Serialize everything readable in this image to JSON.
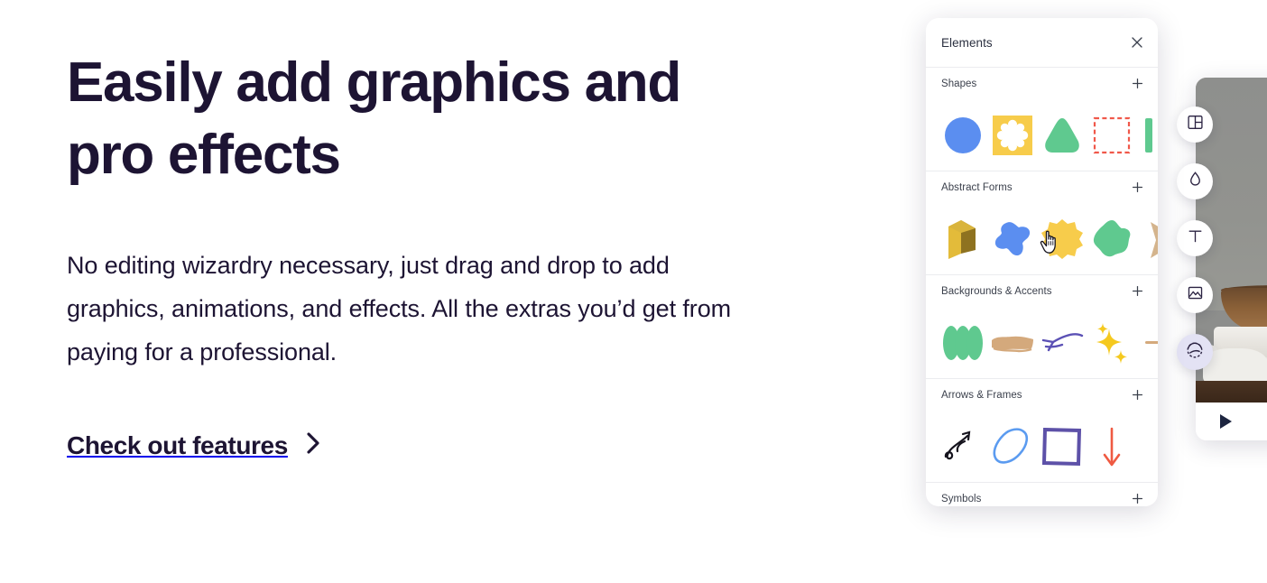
{
  "hero": {
    "headline": "Easily add graphics and pro effects",
    "body": "No editing wizardry necessary, just drag and drop to add graphics, animations, and effects. All the extras you’d get from paying for a professional.",
    "cta_label": "Check out features",
    "cta_icon": "chevron-right-icon",
    "underline_color": "#f5d34f",
    "text_color": "#1d1433"
  },
  "panel": {
    "title": "Elements",
    "close_icon": "close-icon",
    "add_icon": "plus-icon",
    "sections": [
      {
        "label": "Shapes",
        "items": [
          {
            "name": "blue-circle-shape"
          },
          {
            "name": "yellow-flower-square-shape"
          },
          {
            "name": "green-triangle-shape"
          },
          {
            "name": "red-dashed-square-shape"
          },
          {
            "name": "green-bar-shape"
          }
        ]
      },
      {
        "label": "Abstract Forms",
        "items": [
          {
            "name": "gold-3d-form"
          },
          {
            "name": "blue-blob-form"
          },
          {
            "name": "yellow-starburst-form"
          },
          {
            "name": "green-star-blob-form"
          },
          {
            "name": "tan-star-form"
          }
        ]
      },
      {
        "label": "Backgrounds & Accents",
        "items": [
          {
            "name": "green-scallop-background"
          },
          {
            "name": "tan-brush-stroke-accent"
          },
          {
            "name": "purple-swoosh-arrow-accent"
          },
          {
            "name": "yellow-sparkles-accent"
          },
          {
            "name": "tan-dash-accent"
          }
        ]
      },
      {
        "label": "Arrows & Frames",
        "items": [
          {
            "name": "black-curly-arrow"
          },
          {
            "name": "blue-hand-drawn-ellipse"
          },
          {
            "name": "purple-square-frame"
          },
          {
            "name": "red-down-arrow"
          }
        ]
      },
      {
        "label": "Symbols",
        "items": []
      }
    ]
  },
  "toolbar": {
    "buttons": [
      {
        "name": "layout-icon",
        "label": "Layout"
      },
      {
        "name": "droplet-icon",
        "label": "Color"
      },
      {
        "name": "text-icon",
        "label": "Text"
      },
      {
        "name": "image-icon",
        "label": "Media"
      },
      {
        "name": "effects-icon",
        "label": "Elements"
      }
    ],
    "active_index": 4,
    "active_bg": "#e3e2f4"
  },
  "preview": {
    "play_icon": "play-icon"
  },
  "cursor": {
    "type": "pointing-hand-cursor"
  }
}
